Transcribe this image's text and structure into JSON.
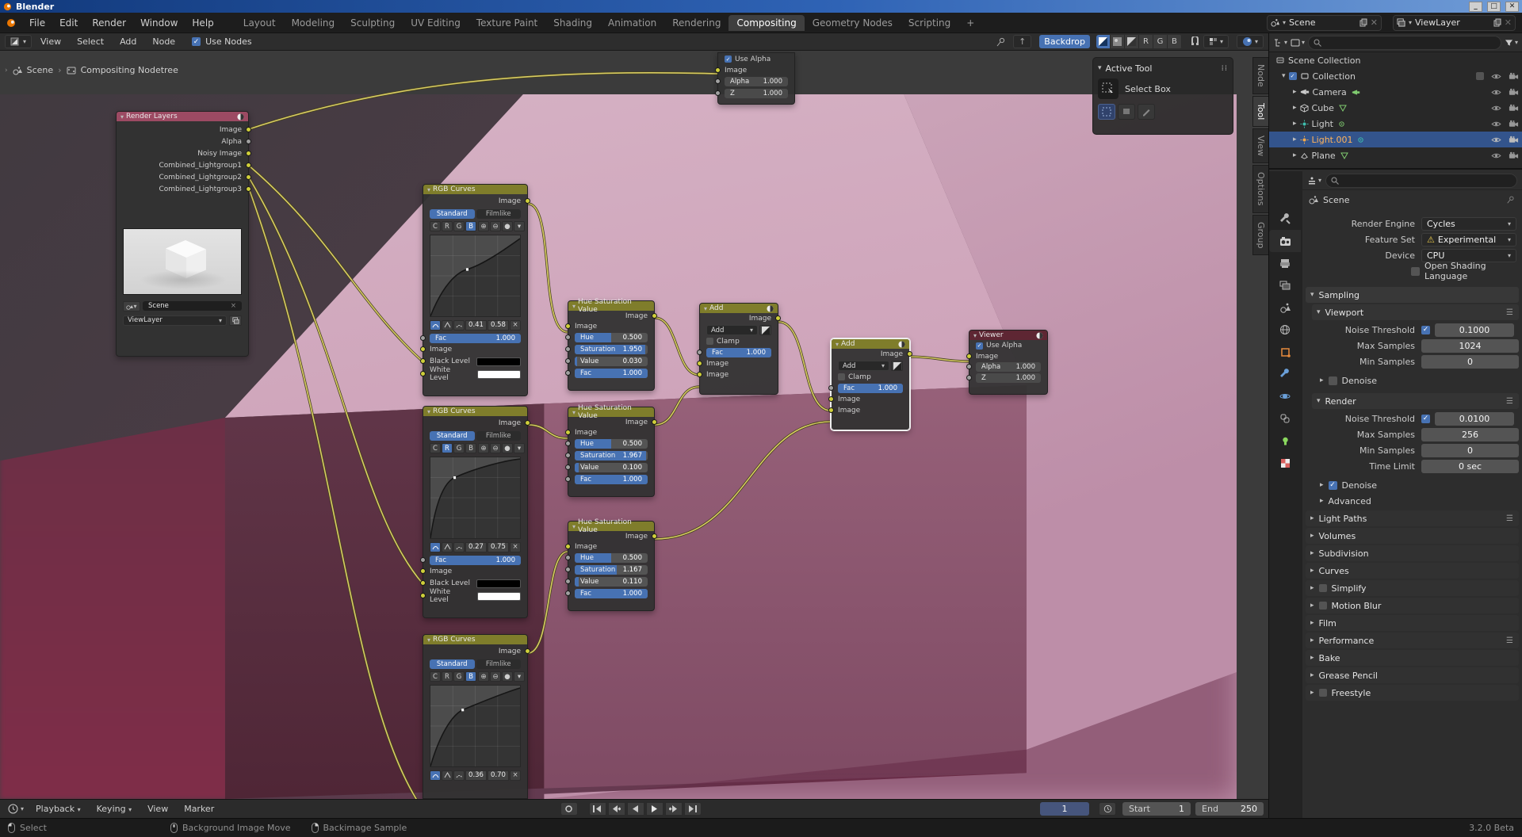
{
  "window": {
    "title": "Blender"
  },
  "topbar": {
    "menus": [
      "File",
      "Edit",
      "Render",
      "Window",
      "Help"
    ],
    "workspaces": [
      "Layout",
      "Modeling",
      "Sculpting",
      "UV Editing",
      "Texture Paint",
      "Shading",
      "Animation",
      "Rendering",
      "Compositing",
      "Geometry Nodes",
      "Scripting",
      "+"
    ],
    "scene_value": "Scene",
    "viewlayer_value": "ViewLayer"
  },
  "editor": {
    "menus": [
      "View",
      "Select",
      "Add",
      "Node"
    ],
    "use_nodes_label": "Use Nodes",
    "backdrop_label": "Backdrop",
    "channel_r": "R",
    "channel_g": "G",
    "channel_b": "B",
    "breadcrumb_scene": "Scene",
    "breadcrumb_tree": "Compositing Nodetree",
    "side_tabs": [
      "Node",
      "Tool",
      "View",
      "Options",
      "Group"
    ],
    "active_tool_title": "Active Tool",
    "active_tool_name": "Select Box"
  },
  "nodes": {
    "shared": {
      "image": "Image",
      "fac": "Fac",
      "standard": "Standard",
      "filmlike": "Filmlike",
      "c": "C",
      "r": "R",
      "g": "G",
      "b": "B",
      "black_level": "Black Level",
      "white_level": "White Level",
      "clamp": "Clamp",
      "use_alpha": "Use Alpha",
      "alpha": "Alpha",
      "z": "Z"
    },
    "render_layers": {
      "title": "Render Layers",
      "outputs": [
        "Image",
        "Alpha",
        "Noisy Image",
        "Combined_Lightgroup1",
        "Combined_Lightgroup2",
        "Combined_Lightgroup3"
      ],
      "scene": "Scene",
      "view_layer": "ViewLayer"
    },
    "top_node": {
      "alpha_value": "1.000",
      "z_value": "1.000"
    },
    "rgb1": {
      "title": "RGB Curves",
      "x": "0.41",
      "y": "0.58",
      "fac_value": "1.000"
    },
    "rgb2": {
      "title": "RGB Curves",
      "x": "0.27",
      "y": "0.75",
      "fac_value": "1.000"
    },
    "rgb3": {
      "title": "RGB Curves",
      "x": "0.36",
      "y": "0.70"
    },
    "hsv1": {
      "title": "Hue Saturation Value",
      "rows": [
        {
          "label": "Hue",
          "value": "0.500",
          "fill": 0.5
        },
        {
          "label": "Saturation",
          "value": "1.950",
          "fill": 0.97
        },
        {
          "label": "Value",
          "value": "0.030",
          "fill": 0.03
        },
        {
          "label": "Fac",
          "value": "1.000",
          "fill": 1
        }
      ]
    },
    "hsv2": {
      "title": "Hue Saturation Value",
      "rows": [
        {
          "label": "Hue",
          "value": "0.500",
          "fill": 0.5
        },
        {
          "label": "Saturation",
          "value": "1.967",
          "fill": 0.98
        },
        {
          "label": "Value",
          "value": "0.100",
          "fill": 0.05
        },
        {
          "label": "Fac",
          "value": "1.000",
          "fill": 1
        }
      ]
    },
    "hsv3": {
      "title": "Hue Saturation Value",
      "rows": [
        {
          "label": "Hue",
          "value": "0.500",
          "fill": 0.5
        },
        {
          "label": "Saturation",
          "value": "1.167",
          "fill": 0.58
        },
        {
          "label": "Value",
          "value": "0.110",
          "fill": 0.055
        },
        {
          "label": "Fac",
          "value": "1.000",
          "fill": 1
        }
      ]
    },
    "add1": {
      "title": "Add",
      "op": "Add",
      "fac_value": "1.000"
    },
    "add2": {
      "title": "Add",
      "op": "Add",
      "fac_value": "1.000"
    },
    "viewer": {
      "title": "Viewer",
      "alpha_value": "1.000",
      "z_value": "1.000"
    }
  },
  "outliner": {
    "rows": [
      {
        "name": "Scene Collection"
      },
      {
        "name": "Collection"
      },
      {
        "name": "Camera"
      },
      {
        "name": "Cube"
      },
      {
        "name": "Light"
      },
      {
        "name": "Light.001"
      },
      {
        "name": "Plane"
      }
    ]
  },
  "props": {
    "nav_title": "Scene",
    "engine_label": "Render Engine",
    "engine_value": "Cycles",
    "feature_label": "Feature Set",
    "feature_value": "Experimental",
    "device_label": "Device",
    "device_value": "CPU",
    "osl_label": "Open Shading Language",
    "sampling_title": "Sampling",
    "viewport_title": "Viewport",
    "render_title": "Render",
    "noise_label": "Noise Threshold",
    "max_label": "Max Samples",
    "min_label": "Min Samples",
    "time_label": "Time Limit",
    "vp_noise": "0.1000",
    "vp_max": "1024",
    "vp_min": "0",
    "r_noise": "0.0100",
    "r_max": "256",
    "r_min": "0",
    "time_value": "0 sec",
    "denoise_label": "Denoise",
    "advanced_label": "Advanced",
    "collapsed": [
      "Light Paths",
      "Volumes",
      "Subdivision",
      "Curves",
      "Simplify",
      "Motion Blur",
      "Film",
      "Performance",
      "Bake",
      "Grease Pencil",
      "Freestyle"
    ]
  },
  "timeline": {
    "playback": "Playback",
    "keying": "Keying",
    "view": "View",
    "marker": "Marker",
    "frame": "1",
    "start_label": "Start",
    "start_value": "1",
    "end_label": "End",
    "end_value": "250"
  },
  "status": {
    "select": "Select",
    "move": "Background Image Move",
    "sample": "Backimage Sample",
    "version": "3.2.0 Beta"
  }
}
